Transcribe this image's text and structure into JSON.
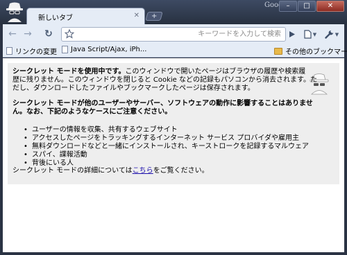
{
  "window": {
    "brand": "Google",
    "buttons": {
      "minimize": "–",
      "maximize": "□",
      "close": "✕"
    }
  },
  "tabs": [
    {
      "title": "新しいタブ",
      "close": "✕"
    }
  ],
  "new_tab": "+",
  "toolbar": {
    "back": "←",
    "forward": "→",
    "reload": "↻",
    "omnibox_value": "",
    "omnibox_placeholder": "キーワードを入力して検索"
  },
  "bookmarks": {
    "items": [
      {
        "label": "リンクの変更",
        "icon": "document-icon"
      },
      {
        "label": "Java Script/Ajax, iPh...",
        "icon": "document-icon"
      }
    ],
    "other": {
      "label": "その他のブックマーク",
      "icon": "folder-icon"
    }
  },
  "incognito": {
    "intro_lead": "シークレット モードを使用中です。",
    "intro_lines": [
      "このウィンドウで開いたページはブラウザの履歴や検索履",
      "歴に残りません。このウィンドウを閉じると Cookie などの記録もパソコンから消去されます。た",
      "だし、ダウンロードしたファイルやブックマークしたページは保存されます。"
    ],
    "warning_lines": [
      "シークレット モードが他のユーザーやサーバー、ソフトウェアの動作に影響することはありませ",
      "ん。なお、下記のようなケースにご注意ください。"
    ],
    "cases": [
      "ユーザーの情報を収集、共有するウェブサイト",
      "アクセスしたページをトラッキングするインターネット サービス プロバイダや雇用主",
      "無料ダウンロードなどと一緒にインストールされ、キーストロークを記録するマルウェア",
      "スパイ、諜報活動",
      "背後にいる人"
    ],
    "details_prefix": "シークレット モードの詳細については",
    "details_link": "こちら",
    "details_suffix": "をご覧ください。"
  },
  "colors": {
    "frame": "#2b3344",
    "toolbar": "#e5ecf6",
    "notice_box": "#eeeeee",
    "link": "#1a0dab"
  }
}
